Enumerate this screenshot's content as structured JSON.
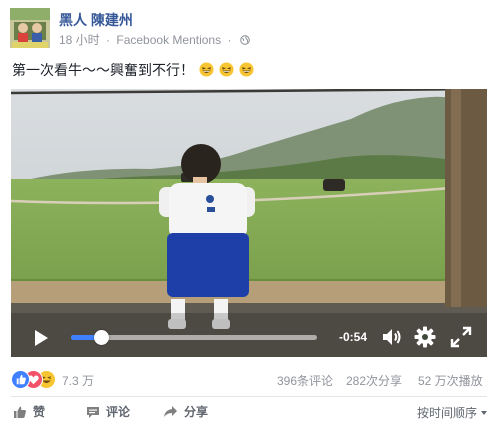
{
  "post": {
    "author": "黑人 陳建州",
    "time": "18 小时",
    "via": "Facebook Mentions",
    "separator": "·",
    "text": "第一次看牛～～興奮到不行！",
    "emoji_icon": "grinning-squint-face-icon"
  },
  "video": {
    "remaining_time": "-0:54",
    "progress_fraction": 0.12
  },
  "stats": {
    "reaction_count": "7.3 万",
    "comments": "396条评论",
    "shares": "282次分享",
    "views": "52 万次播放"
  },
  "actions": {
    "like": "赞",
    "comment": "评论",
    "share": "分享",
    "sort": "按时间顺序"
  },
  "colors": {
    "link": "#365899",
    "progress": "#4080ff",
    "like": "#4080ff",
    "love": "#f25268"
  }
}
